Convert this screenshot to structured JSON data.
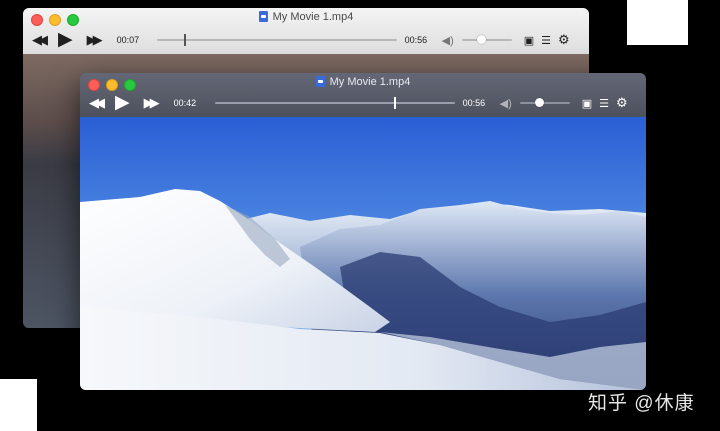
{
  "back_window": {
    "title": "My Movie 1.mp4",
    "current_time": "00:07",
    "total_time": "00:56",
    "progress": 0.12,
    "volume": 0.4,
    "icons": [
      "rewind-icon",
      "play-icon",
      "fast-forward-icon",
      "volume-icon",
      "picture-in-picture-icon",
      "playlist-icon",
      "gear-icon"
    ]
  },
  "front_window": {
    "title": "My Movie 1.mp4",
    "current_time": "00:42",
    "total_time": "00:56",
    "progress": 0.75,
    "volume": 0.4,
    "icons": [
      "rewind-icon",
      "play-icon",
      "fast-forward-icon",
      "volume-icon",
      "picture-in-picture-icon",
      "playlist-icon",
      "gear-icon"
    ]
  },
  "video_scene": "snowy-mountains",
  "watermark": "知乎 @休康",
  "colors": {
    "sky_top": "#2d63d6",
    "sky_bottom": "#9cc7ec",
    "snow": "#f4f7fb",
    "titlebar_dark": "#565a67"
  }
}
